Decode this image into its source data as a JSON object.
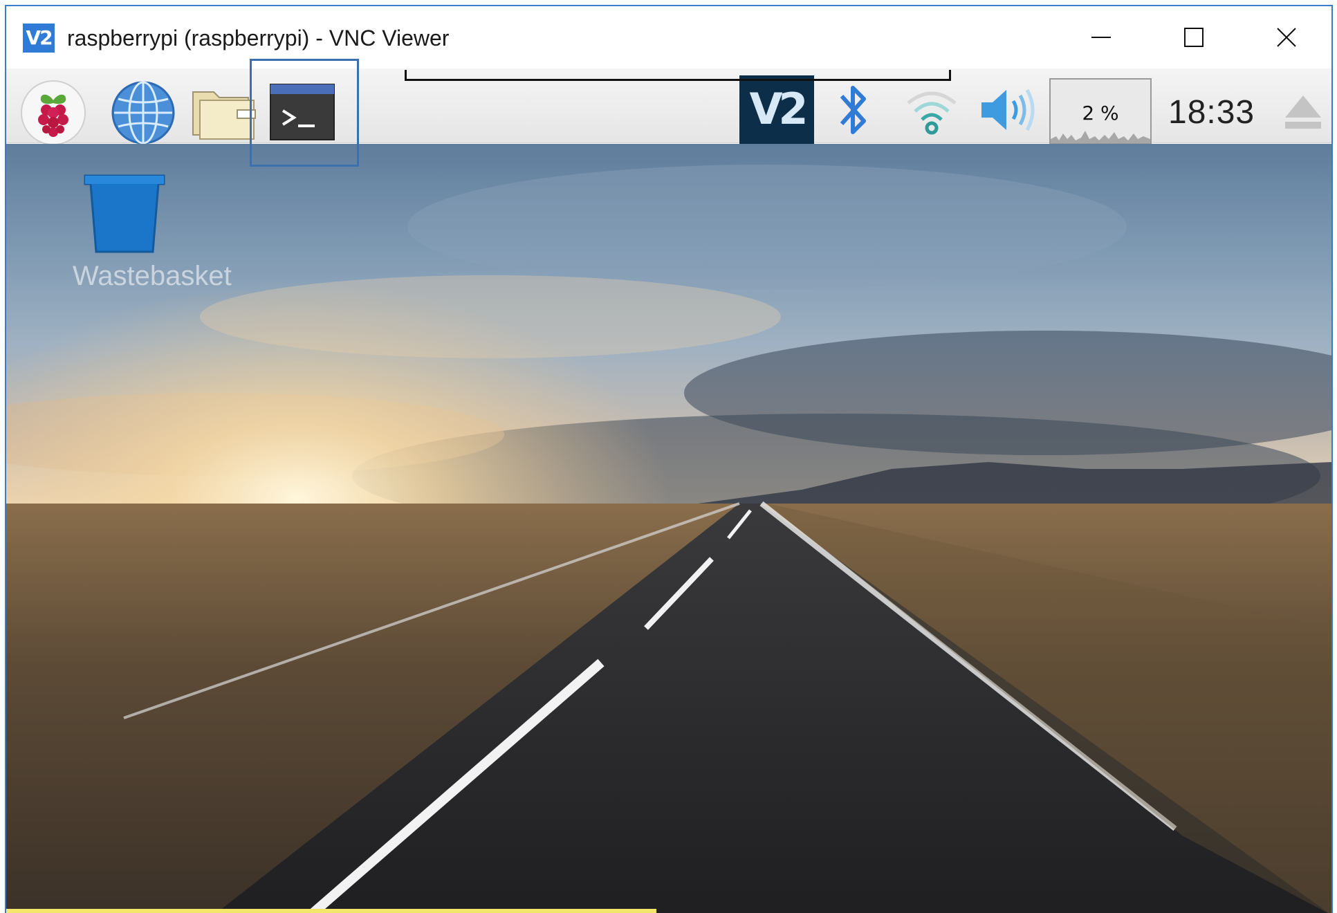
{
  "titlebar": {
    "app_logo": "V2",
    "title": "raspberrypi (raspberrypi) - VNC Viewer",
    "controls": [
      "minimize-icon",
      "maximize-icon",
      "close-icon"
    ]
  },
  "panel": {
    "launchers": [
      {
        "name": "raspberry-menu",
        "icon": "raspberry-icon"
      },
      {
        "name": "web-browser",
        "icon": "globe-icon"
      },
      {
        "name": "file-manager",
        "icon": "folder-icon"
      },
      {
        "name": "terminal",
        "icon": "terminal-icon"
      }
    ],
    "tray": {
      "vnc_label": "V2",
      "bluetooth_icon": "bluetooth-icon",
      "wifi_icon": "wifi-icon",
      "volume_icon": "volume-icon",
      "cpu_usage": "2 %",
      "clock": "18:33",
      "eject_icon": "eject-icon"
    }
  },
  "desktop": {
    "trash": {
      "icon": "trash-icon",
      "label": "Wastebasket"
    }
  },
  "colors": {
    "window_border": "#3c78c8",
    "highlight_box": "#3b6fae",
    "vnc_tray_bg": "#0d2e48",
    "bluetooth": "#2f7bd6"
  }
}
